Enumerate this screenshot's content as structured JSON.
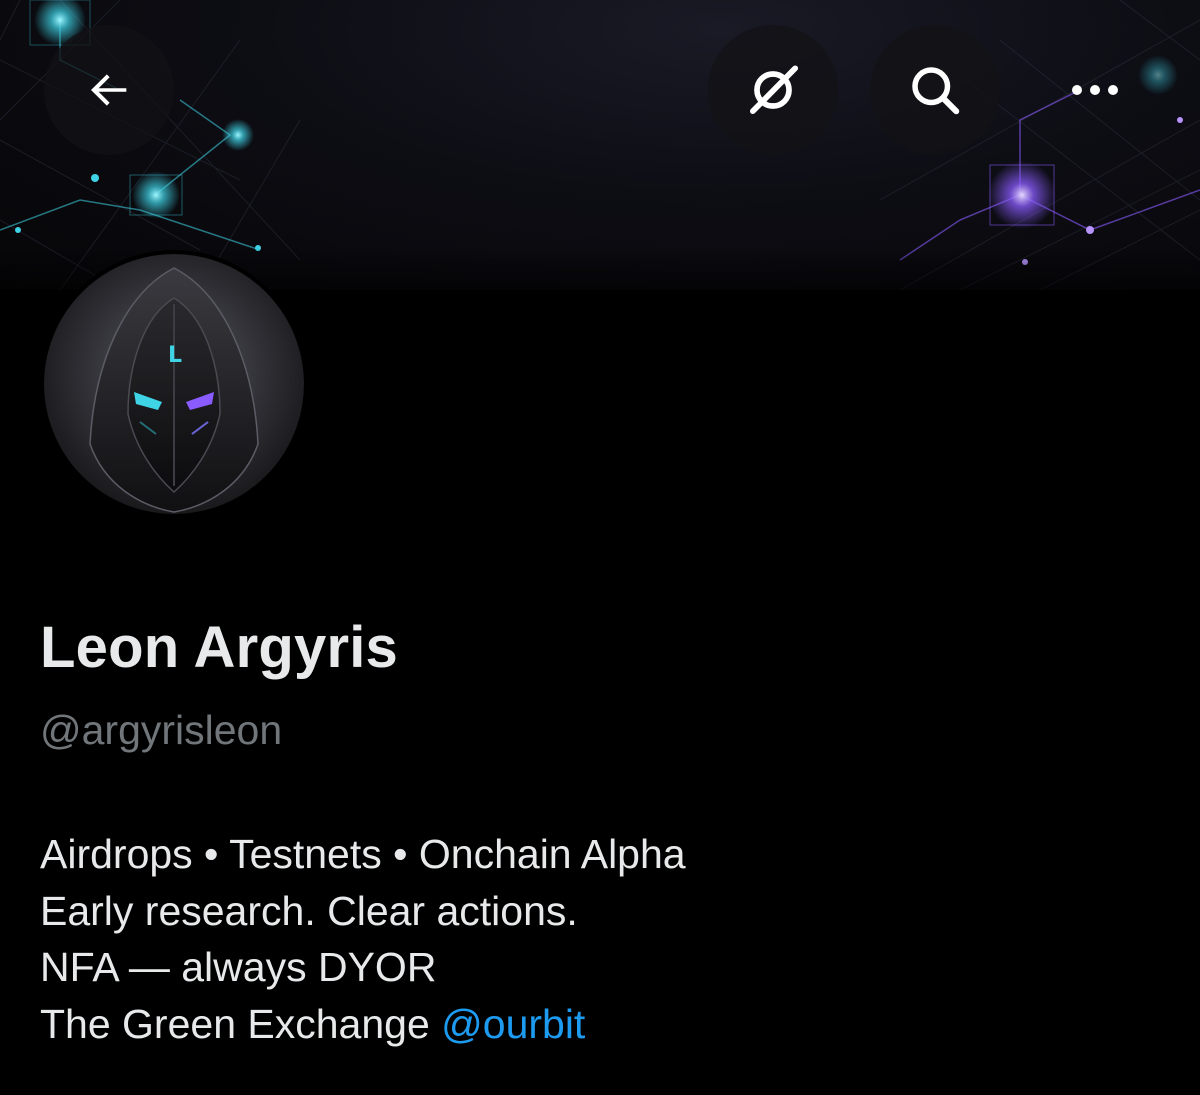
{
  "topbar": {
    "back_icon": "arrow-left-icon",
    "grok_icon": "grok-icon",
    "search_icon": "search-icon",
    "more_icon": "more-horizontal-icon"
  },
  "profile": {
    "display_name": "Leon Argyris",
    "handle": "@argyrisleon",
    "avatar_letter": "L",
    "bio": {
      "line1": "Airdrops • Testnets • Onchain Alpha",
      "line2": "Early research. Clear actions.",
      "line3": "NFA — always DYOR",
      "line4_prefix": "The Green Exchange ",
      "line4_mention": "@ourbit"
    }
  },
  "colors": {
    "background": "#000000",
    "text_primary": "#e7e9ea",
    "text_secondary": "#71767b",
    "link": "#1d9bf0",
    "banner_cyan": "#3fd3e6",
    "banner_purple": "#8a5cff"
  }
}
